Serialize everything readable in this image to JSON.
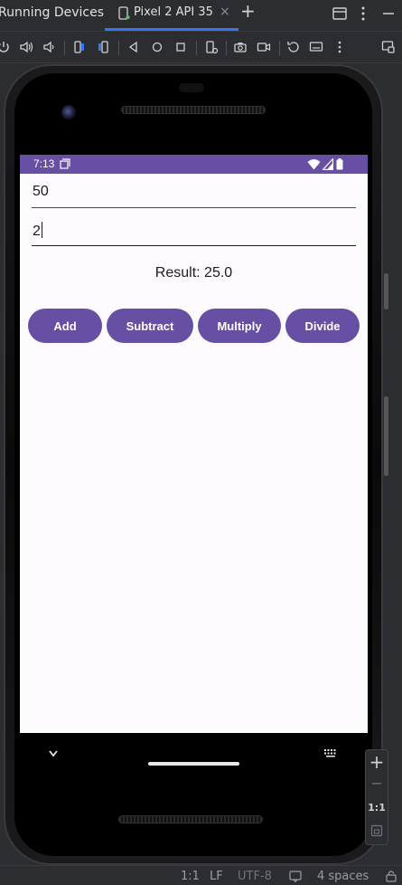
{
  "ide": {
    "tool_window_title": "Running Devices",
    "tab_label": "Pixel 2 API 35",
    "tab_close": "×",
    "tab_add": "+",
    "accent": "#3574f0"
  },
  "device": {
    "status_time": "7:13",
    "theme_color": "#6750a4",
    "first_number": "50",
    "second_number": "2",
    "result_text": "Result: 25.0",
    "buttons": [
      "Add",
      "Subtract",
      "Multiply",
      "Divide"
    ]
  },
  "zoom_panel": {
    "plus": "+",
    "minus": "−",
    "actual_size": "1:1"
  },
  "status_bar": {
    "position": "1:1",
    "line_sep": "LF",
    "encoding": "UTF-8",
    "indent": "4 spaces"
  }
}
